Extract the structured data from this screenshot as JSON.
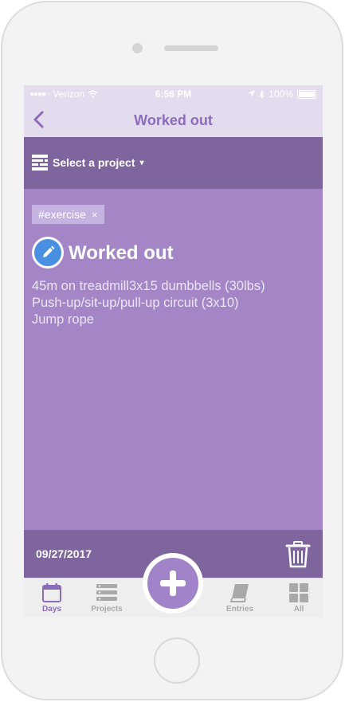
{
  "status_bar": {
    "carrier": "Verizon",
    "time": "6:56 PM",
    "battery": "100%"
  },
  "nav": {
    "title": "Worked out",
    "back_icon": "chevron-left-icon"
  },
  "project": {
    "select_label": "Select a project",
    "caret": "▾"
  },
  "entry": {
    "tag": "#exercise",
    "tag_remove": "×",
    "title": "Worked out",
    "body_lines": [
      "45m on treadmill3x15 dumbbells (30lbs)",
      "Push-up/sit-up/pull-up circuit (3x10)",
      "Jump rope"
    ],
    "date": "09/27/2017"
  },
  "tabs": [
    {
      "label": "Days",
      "icon": "calendar-icon",
      "active": true
    },
    {
      "label": "Projects",
      "icon": "stack-icon",
      "active": false
    },
    {
      "label": "Entries",
      "icon": "book-icon",
      "active": false
    },
    {
      "label": "All",
      "icon": "grid-icon",
      "active": false
    }
  ],
  "colors": {
    "accent": "#8a6cb8",
    "content_bg": "#a486c6",
    "bar_bg": "#7e659e",
    "nav_bg": "#e3dcee",
    "edit_blue": "#4a90e2"
  }
}
